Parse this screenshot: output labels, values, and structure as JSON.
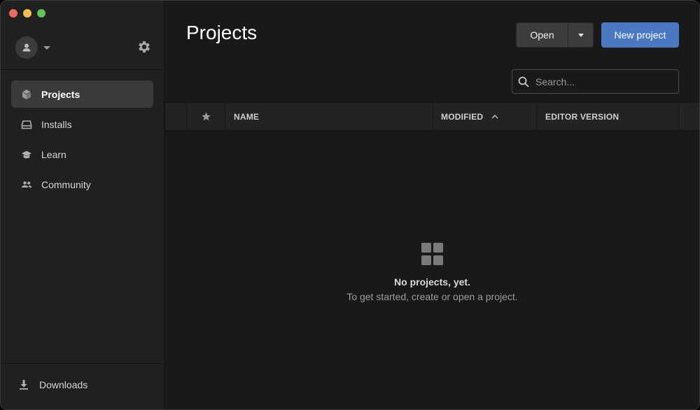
{
  "sidebar": {
    "items": [
      {
        "label": "Projects",
        "icon": "cube-icon",
        "active": true
      },
      {
        "label": "Installs",
        "icon": "installs-icon",
        "active": false
      },
      {
        "label": "Learn",
        "icon": "graduation-cap-icon",
        "active": false
      },
      {
        "label": "Community",
        "icon": "people-icon",
        "active": false
      }
    ],
    "downloads_label": "Downloads"
  },
  "main": {
    "title": "Projects",
    "open_label": "Open",
    "new_project_label": "New project",
    "search": {
      "placeholder": "Search..."
    },
    "columns": {
      "name": "NAME",
      "modified": "MODIFIED",
      "editor_version": "EDITOR VERSION"
    },
    "empty_state": {
      "title": "No projects, yet.",
      "subtitle": "To get started, create or open a project."
    }
  },
  "colors": {
    "accent": "#4a78c2",
    "background": "#191919",
    "sidebar": "#202020"
  }
}
